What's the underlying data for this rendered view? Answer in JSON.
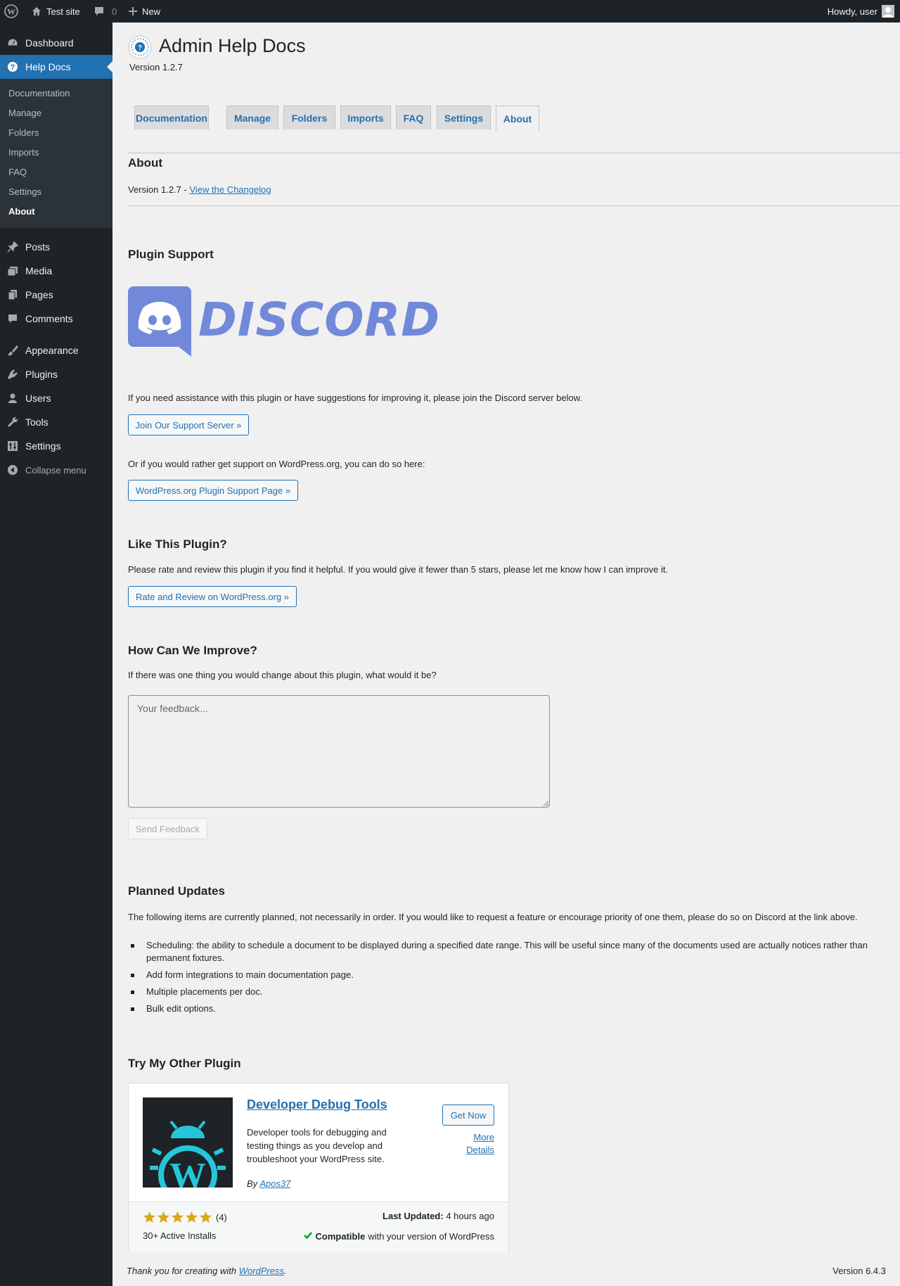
{
  "adminbar": {
    "site_name": "Test site",
    "comments_count": "0",
    "new_label": "New",
    "howdy": "Howdy, user"
  },
  "sidebar": {
    "items": [
      {
        "label": "Dashboard",
        "icon": "dashboard-icon"
      },
      {
        "label": "Help Docs",
        "icon": "help-icon"
      },
      {
        "label": "Posts",
        "icon": "pin-icon"
      },
      {
        "label": "Media",
        "icon": "media-icon"
      },
      {
        "label": "Pages",
        "icon": "pages-icon"
      },
      {
        "label": "Comments",
        "icon": "comment-icon"
      },
      {
        "label": "Appearance",
        "icon": "brush-icon"
      },
      {
        "label": "Plugins",
        "icon": "plugin-icon"
      },
      {
        "label": "Users",
        "icon": "user-icon"
      },
      {
        "label": "Tools",
        "icon": "wrench-icon"
      },
      {
        "label": "Settings",
        "icon": "settings-icon"
      }
    ],
    "submenu": [
      "Documentation",
      "Manage",
      "Folders",
      "Imports",
      "FAQ",
      "Settings",
      "About"
    ],
    "collapse_label": "Collapse menu"
  },
  "page": {
    "title": "Admin Help Docs",
    "version": "Version 1.2.7",
    "tabs": [
      "Documentation",
      "Manage",
      "Folders",
      "Imports",
      "FAQ",
      "Settings",
      "About"
    ],
    "active_tab": "About"
  },
  "about": {
    "heading": "About",
    "version_prefix": "Version 1.2.7 - ",
    "changelog_link": "View the Changelog"
  },
  "support": {
    "heading": "Plugin Support",
    "logo_text": "DISCORD",
    "intro": "If you need assistance with this plugin or have suggestions for improving it, please join the Discord server below.",
    "discord_button": "Join Our Support Server »",
    "wporg_intro": "Or if you would rather get support on WordPress.org, you can do so here:",
    "wporg_button": "WordPress.org Plugin Support Page »"
  },
  "like": {
    "heading": "Like This Plugin?",
    "text": "Please rate and review this plugin if you find it helpful. If you would give it fewer than 5 stars, please let me know how I can improve it.",
    "button": "Rate and Review on WordPress.org »"
  },
  "improve": {
    "heading": "How Can We Improve?",
    "question": "If there was one thing you would change about this plugin, what would it be?",
    "placeholder": "Your feedback...",
    "send_button": "Send Feedback"
  },
  "planned": {
    "heading": "Planned Updates",
    "intro": "The following items are currently planned, not necessarily in order. If you would like to request a feature or encourage priority of one them, please do so on Discord at the link above.",
    "items": [
      "Scheduling: the ability to schedule a document to be displayed during a specified date range. This will be useful since many of the documents used are actually notices rather than permanent fixtures.",
      "Add form integrations to main documentation page.",
      "Multiple placements per doc.",
      "Bulk edit options."
    ]
  },
  "other_plugin": {
    "heading": "Try My Other Plugin",
    "name": "Developer Debug Tools",
    "description": "Developer tools for debugging and testing things as you develop and troubleshoot your WordPress site.",
    "by_prefix": "By ",
    "author": "Apos37",
    "get_now": "Get Now",
    "more_details_1": "More",
    "more_details_2": "Details",
    "rating_stars": 5,
    "rating_count": "(4)",
    "active_installs": "30+ Active Installs",
    "last_updated_label": "Last Updated:",
    "last_updated_value": "4 hours ago",
    "compatible_label": "Compatible",
    "compatible_suffix": "with your version of WordPress",
    "star_color": "#dba617",
    "thumb_bg": "#1d2327",
    "thumb_fg": "#26c6da"
  },
  "footer": {
    "thanks_prefix": "Thank you for creating with ",
    "wp_link": "WordPress",
    "thanks_suffix": ".",
    "version": "Version 6.4.3"
  },
  "colors": {
    "accent": "#2271b1",
    "discord": "#7289da",
    "adminbar": "#1d2327"
  }
}
